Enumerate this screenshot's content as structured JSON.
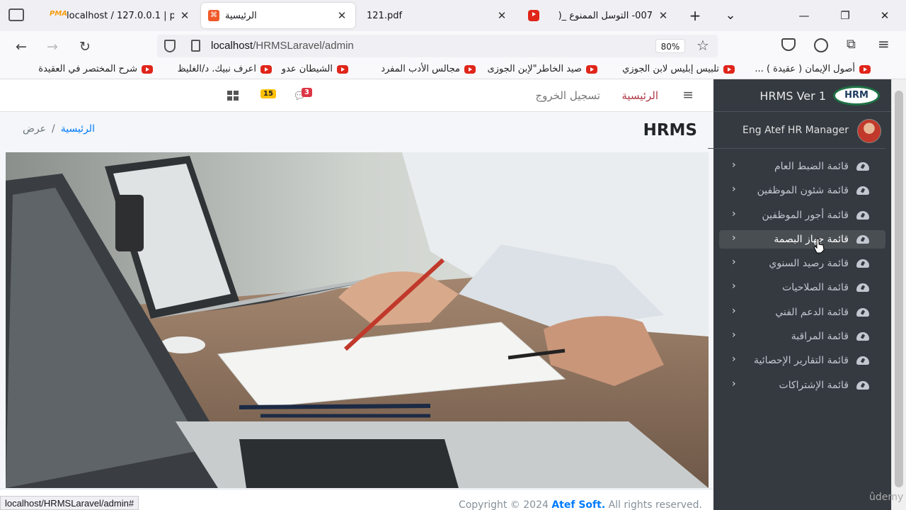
{
  "browser": {
    "tabs": [
      {
        "label": "localhost / 127.0.0.1 | p",
        "icon": "phpmyadmin-icon"
      },
      {
        "label": "الرئيسية",
        "icon": "app-icon",
        "active": true
      },
      {
        "label": "121.pdf",
        "icon": "pdf-icon"
      },
      {
        "label": "007- التوسل الممنوع _(",
        "icon": "youtube-icon"
      }
    ],
    "new_tab": "+",
    "tab_list": "⌄",
    "window": {
      "minimize": "—",
      "restore": "❐",
      "close": "✕"
    },
    "back": "←",
    "forward": "→",
    "reload": "↻",
    "url_host": "localhost",
    "url_path": "/HRMSLaravel/admin",
    "zoom": "80%",
    "bookmarks": [
      "أصول الإيمان ( عقيدة ) ...",
      "تلبيس إبليس لابن الجوزي",
      "صيد الخاطر\"لإبن الجوزى",
      "مجالس الأدب المفرد",
      "الشيطان عدو",
      "اعرف نبيك. د/الغليظ",
      "شرح المختصر في العقيدة"
    ],
    "status_url": "localhost/HRMSLaravel/admin#"
  },
  "sidebar": {
    "brand_logo": "HRM",
    "brand_text": "HRMS Ver 1",
    "user_name": "Eng Atef HR Manager",
    "items": [
      {
        "label": "قائمة الضبط العام"
      },
      {
        "label": "قائمة شئون الموظفين"
      },
      {
        "label": "قائمة أجور الموظفين"
      },
      {
        "label": "قائمة جهاز البصمة",
        "hover": true
      },
      {
        "label": "قائمة رصيد السنوي"
      },
      {
        "label": "قائمة الصلاحيات"
      },
      {
        "label": "قائمة الدعم الفني"
      },
      {
        "label": "قائمة المراقبة"
      },
      {
        "label": "قائمة التقارير الإحصائية"
      },
      {
        "label": "قائمة الإشتراكات"
      }
    ],
    "chevron": "‹"
  },
  "topnav": {
    "menu_toggle": "≡",
    "home": "الرئيسية",
    "logout": "تسجيل الخروج",
    "messages_count": "3",
    "notifications_count": "15"
  },
  "content": {
    "page_title": "HRMS",
    "breadcrumb_home": "الرئيسية",
    "breadcrumb_sep": "/",
    "breadcrumb_current": "عرض"
  },
  "footer": {
    "prefix": "Copyright © 2024 ",
    "company": "Atef Soft.",
    "suffix": " All rights reserved."
  },
  "watermark": "ûdemy"
}
